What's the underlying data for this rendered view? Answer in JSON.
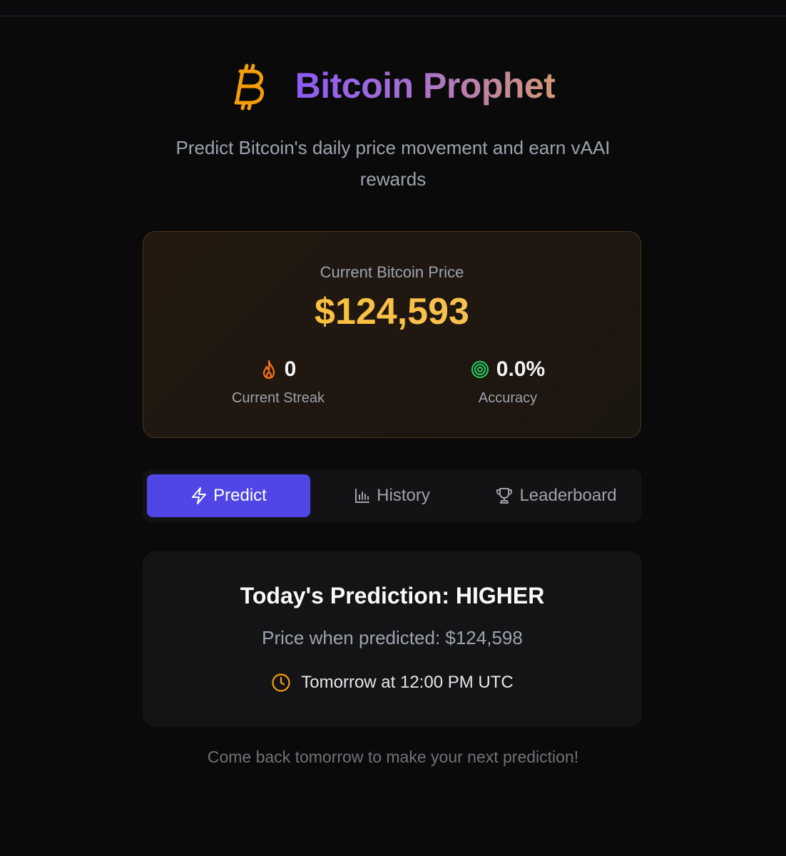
{
  "header": {
    "logo_icon": "bitcoin-icon",
    "title": "Bitcoin Prophet",
    "subtitle": "Predict Bitcoin's daily price movement and earn vAAI rewards"
  },
  "price_card": {
    "label": "Current Bitcoin Price",
    "price": "$124,593",
    "streak": {
      "icon": "flame-icon",
      "value": "0",
      "label": "Current Streak"
    },
    "accuracy": {
      "icon": "target-icon",
      "value": "0.0%",
      "label": "Accuracy"
    }
  },
  "tabs": [
    {
      "label": "Predict",
      "icon": "zap-icon",
      "active": true
    },
    {
      "label": "History",
      "icon": "bar-chart-icon",
      "active": false
    },
    {
      "label": "Leaderboard",
      "icon": "trophy-icon",
      "active": false
    }
  ],
  "prediction": {
    "title": "Today's Prediction: HIGHER",
    "price_text": "Price when predicted: $124,598",
    "time_icon": "clock-icon",
    "time_text": "Tomorrow at 12:00 PM UTC"
  },
  "footer": {
    "note": "Come back tomorrow to make your next prediction!"
  },
  "colors": {
    "background": "#0a0a0b",
    "accent": "#4f46e5",
    "price": "#fbbf24",
    "bitcoin": "#f59e0b",
    "accuracy_icon": "#22c55e",
    "streak_icon": "#f97316"
  }
}
